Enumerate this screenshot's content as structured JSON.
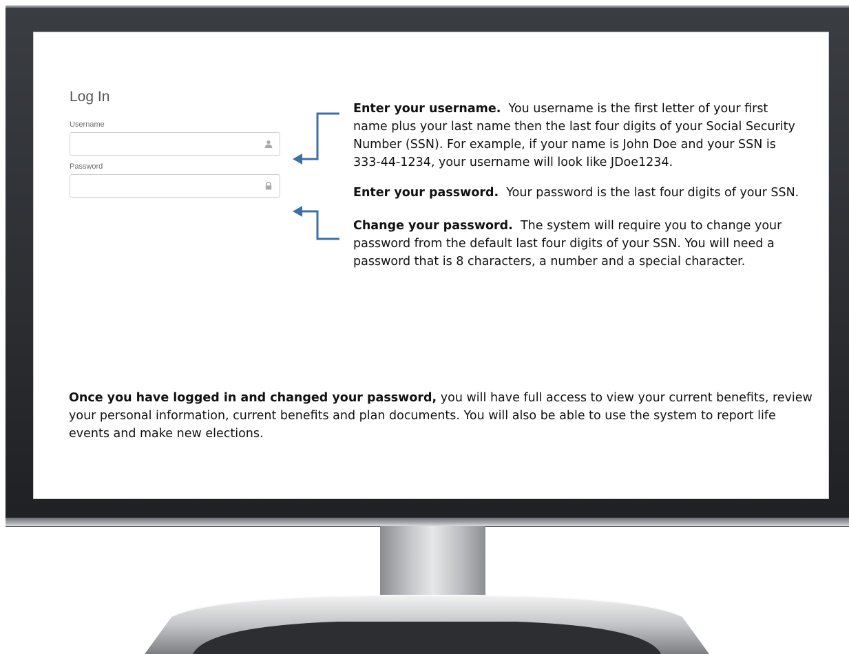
{
  "login": {
    "title": "Log In",
    "username_label": "Username",
    "username_value": "",
    "password_label": "Password",
    "password_value": ""
  },
  "instructions": {
    "username_heading": "Enter your username.",
    "username_text": "You username is the first letter of your first name plus your last name then  the last four digits of your Social Security Number (SSN).  For example, if your name is  John Doe and  your SSN is  333-44-1234, your username will look  like JDoe1234.",
    "password_heading": "Enter your password.",
    "password_text": "Your password is the last four digits of your SSN.",
    "change_heading": "Change your password.",
    "change_text": "The system will require you to change your password from the default last four digits of your SSN.  You will need a password that is 8 characters, a number and a special character."
  },
  "summary": {
    "heading": "Once you have logged in and changed your password,",
    "text": "you will have full access to view your current benefits, review  your personal information, current benefits and plan  documents. You will also be able to use the system to report  life events and make new elections."
  },
  "icons": {
    "username_field": "user-icon",
    "password_field": "lock-icon",
    "callout": "arrow-left-icon"
  },
  "colors": {
    "arrow": "#3e6ea8",
    "bezel": "#2b2d31",
    "screen": "#ffffff"
  }
}
